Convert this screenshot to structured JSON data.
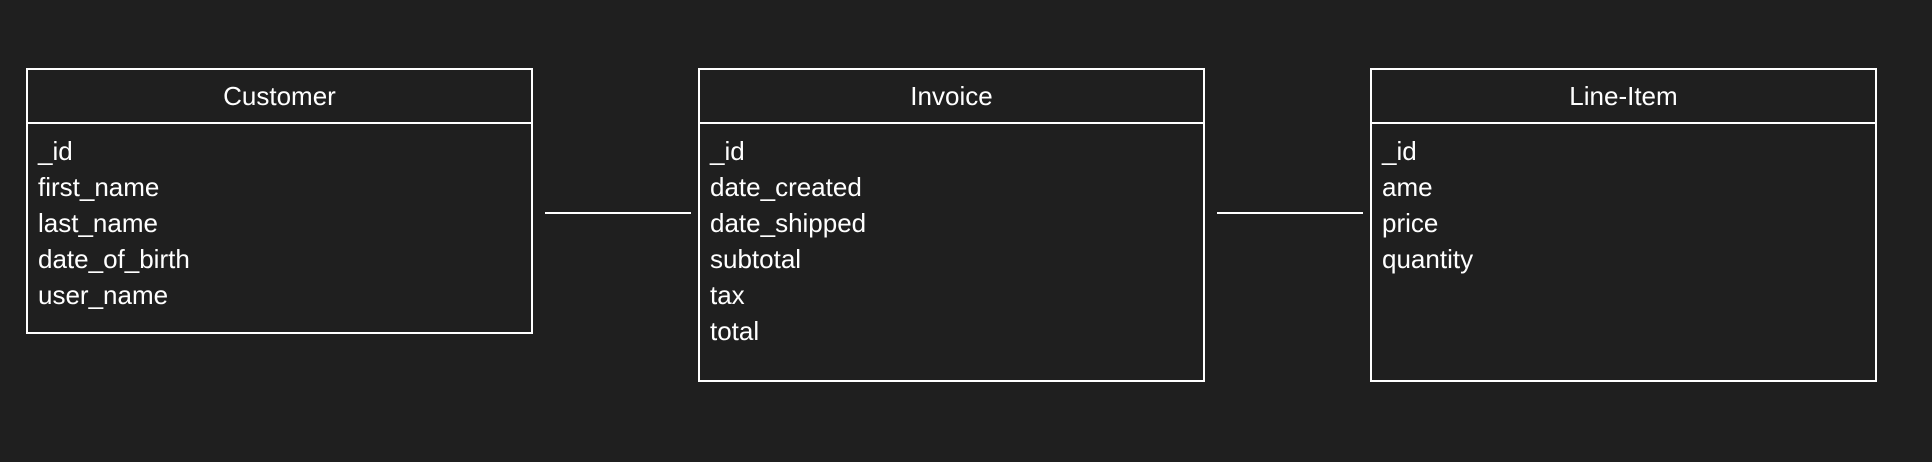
{
  "diagram": {
    "entities": [
      {
        "title": "Customer",
        "fields": [
          "_id",
          "first_name",
          "last_name",
          "date_of_birth",
          "user_name"
        ]
      },
      {
        "title": "Invoice",
        "fields": [
          "_id",
          "date_created",
          "date_shipped",
          "subtotal",
          "tax",
          "total"
        ]
      },
      {
        "title": "Line-Item",
        "fields": [
          "_id",
          "ame",
          "price",
          "quantity"
        ]
      }
    ],
    "relationships": [
      {
        "from": "Customer",
        "to": "Invoice"
      },
      {
        "from": "Invoice",
        "to": "Line-Item"
      }
    ]
  }
}
